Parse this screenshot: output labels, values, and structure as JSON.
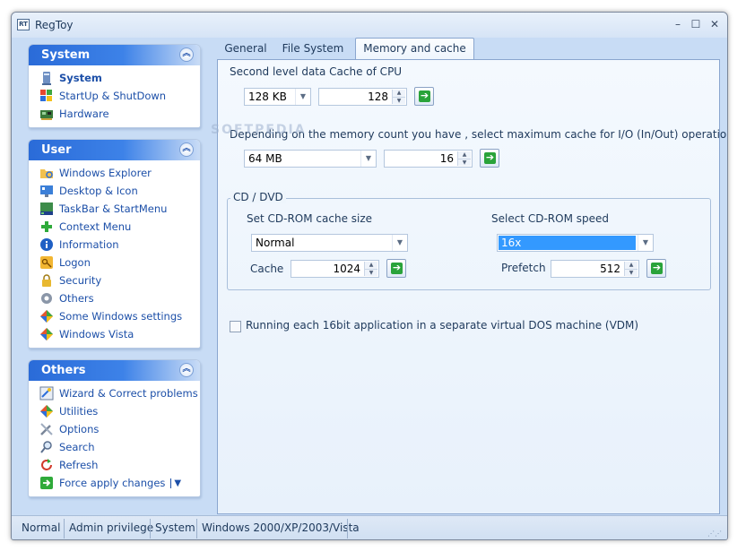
{
  "window": {
    "title": "RegToy",
    "minimize": "–",
    "maximize": "☐",
    "close": "✕"
  },
  "watermark": "SOFTPEDIA",
  "groups": [
    {
      "title": "System",
      "collapse_glyph": "︽",
      "items": [
        {
          "label": "System",
          "icon": "computer-icon",
          "bold": true
        },
        {
          "label": "StartUp & ShutDown",
          "icon": "windows-flag-icon"
        },
        {
          "label": "Hardware",
          "icon": "hardware-icon"
        }
      ]
    },
    {
      "title": "User",
      "collapse_glyph": "︽",
      "items": [
        {
          "label": "Windows Explorer",
          "icon": "folder-icon"
        },
        {
          "label": "Desktop & Icon",
          "icon": "desktop-icon"
        },
        {
          "label": "TaskBar & StartMenu",
          "icon": "taskbar-icon"
        },
        {
          "label": "Context Menu",
          "icon": "plus-icon"
        },
        {
          "label": "Information",
          "icon": "info-icon"
        },
        {
          "label": "Logon",
          "icon": "key-icon"
        },
        {
          "label": "Security",
          "icon": "lock-icon"
        },
        {
          "label": "Others",
          "icon": "gear-icon"
        },
        {
          "label": "Some Windows settings",
          "icon": "diamond-icon"
        },
        {
          "label": "Windows Vista",
          "icon": "diamond-icon"
        }
      ]
    },
    {
      "title": "Others",
      "collapse_glyph": "︽",
      "items": [
        {
          "label": "Wizard & Correct problems",
          "icon": "wizard-icon"
        },
        {
          "label": "Utilities",
          "icon": "diamond-icon"
        },
        {
          "label": "Options",
          "icon": "tools-icon"
        },
        {
          "label": "Search",
          "icon": "search-icon"
        },
        {
          "label": "Refresh",
          "icon": "refresh-icon"
        },
        {
          "label": "Force apply changes",
          "icon": "arrow-right-icon",
          "dropdown": "▼"
        }
      ]
    }
  ],
  "tabs": [
    {
      "label": "General"
    },
    {
      "label": "File System"
    },
    {
      "label": "Memory and cache",
      "active": true
    }
  ],
  "memory": {
    "l2_label": "Second level data Cache of CPU",
    "l2_combo": "128 KB",
    "l2_spin": "128",
    "io_label": "Depending on the memory count you have , select maximum cache for I/O (In/Out) operations .",
    "io_combo": "64 MB",
    "io_spin": "16",
    "cd_legend": "CD / DVD",
    "cd_cache_label": "Set CD-ROM cache size",
    "cd_cache_combo": "Normal",
    "cache_label": "Cache",
    "cache_spin": "1024",
    "cd_speed_label": "Select CD-ROM speed",
    "cd_speed_combo": "16x",
    "prefetch_label": "Prefetch",
    "prefetch_spin": "512",
    "vdm_label": "Running each 16bit application in a separate virtual DOS machine (VDM)",
    "vdm_checked": false
  },
  "glyphs": {
    "dropdown": "▼",
    "spin_up": "▲",
    "spin_down": "▼",
    "go": "➔"
  },
  "statusbar": {
    "mode": "Normal",
    "privilege": "Admin privilege",
    "section": "System",
    "os": "Windows 2000/XP/2003/Vista",
    "grip": "⋰⋰"
  },
  "colors": {
    "accent": "#2a6bd8",
    "window_bg": "#c8dcf5",
    "link": "#1c4fa8",
    "go_green": "#2aa33a",
    "selection": "#3399ff"
  }
}
